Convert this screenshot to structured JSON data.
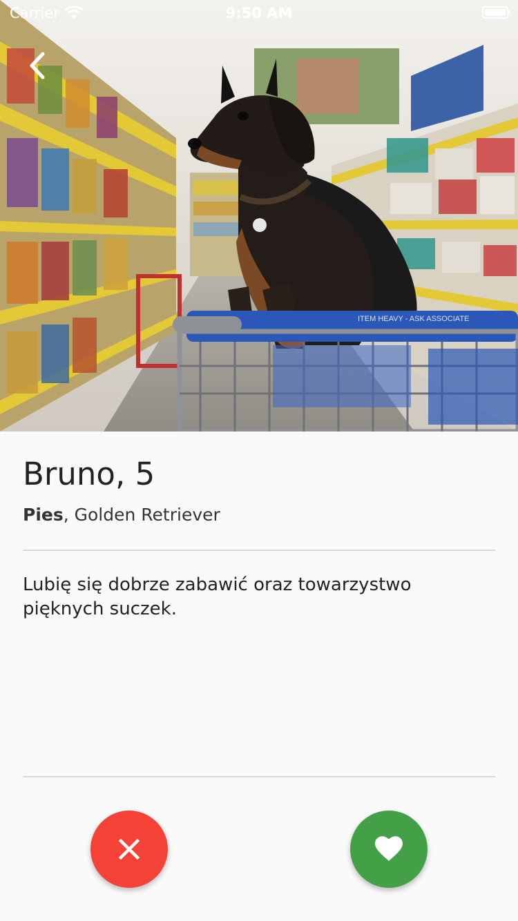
{
  "status_bar": {
    "carrier": "Carrier",
    "time": "9:50 AM"
  },
  "profile": {
    "name": "Bruno",
    "age_separator": ", ",
    "age": "5",
    "species": "Pies",
    "breed_separator": ", ",
    "breed": "Golden Retriever",
    "description": "Lubię się dobrze zabawić oraz towarzystwo pięknych suczek."
  },
  "photo": {
    "cart_sign": "ITEM HEAVY - ASK ASSOCIATE"
  },
  "actions": {
    "dislike_icon": "close-icon",
    "like_icon": "heart-icon"
  },
  "colors": {
    "dislike": "#f44336",
    "like": "#43a047",
    "background": "#fafafa"
  }
}
